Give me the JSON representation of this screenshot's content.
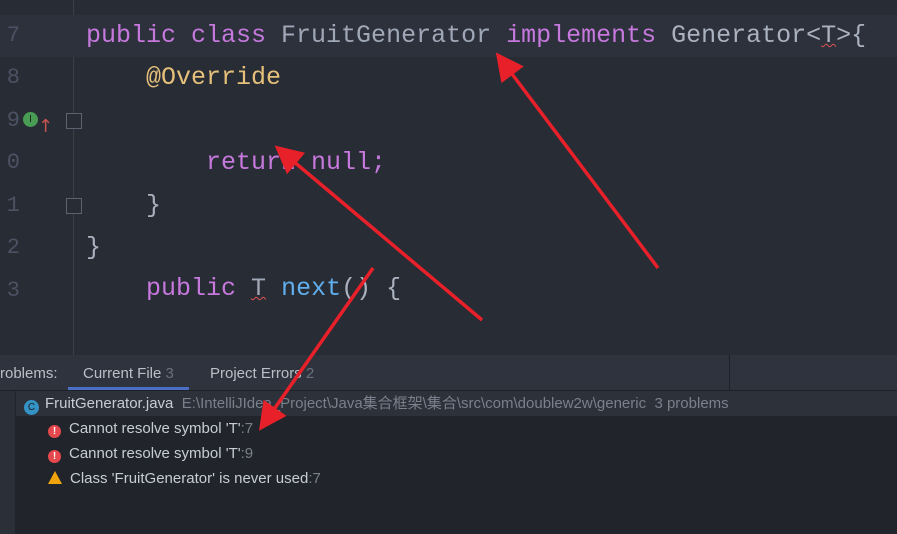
{
  "editor": {
    "lines": [
      {
        "num": "7",
        "parts": [
          "public",
          " class ",
          "FruitGenerator",
          " implements ",
          "Generator<",
          "T",
          ">{"
        ]
      },
      {
        "num": "8",
        "text": "@Override"
      },
      {
        "num": "9",
        "parts": [
          "public",
          " ",
          "T",
          " ",
          "next",
          "() {"
        ]
      },
      {
        "num": "0",
        "parts": [
          "return",
          " null;"
        ]
      },
      {
        "num": "1",
        "text": "}"
      },
      {
        "num": "2",
        "text": "}"
      },
      {
        "num": "3",
        "text": ""
      }
    ]
  },
  "problems": {
    "label": "roblems:",
    "tabs": [
      {
        "label": "Current File",
        "count": "3"
      },
      {
        "label": "Project Errors",
        "count": "2"
      }
    ],
    "file": {
      "name": "FruitGenerator.java",
      "path": "E:\\IntelliJIdea_Project\\Java集合框架\\集合\\src\\com\\doublew2w\\generic",
      "summary": "3 problems"
    },
    "items": [
      {
        "type": "error",
        "text": "Cannot resolve symbol 'T'",
        "line": ":7"
      },
      {
        "type": "error",
        "text": "Cannot resolve symbol 'T'",
        "line": ":9"
      },
      {
        "type": "warning",
        "text": "Class 'FruitGenerator' is never used",
        "line": ":7"
      }
    ]
  },
  "colors": {
    "annotation_arrows": "#e8202a"
  }
}
